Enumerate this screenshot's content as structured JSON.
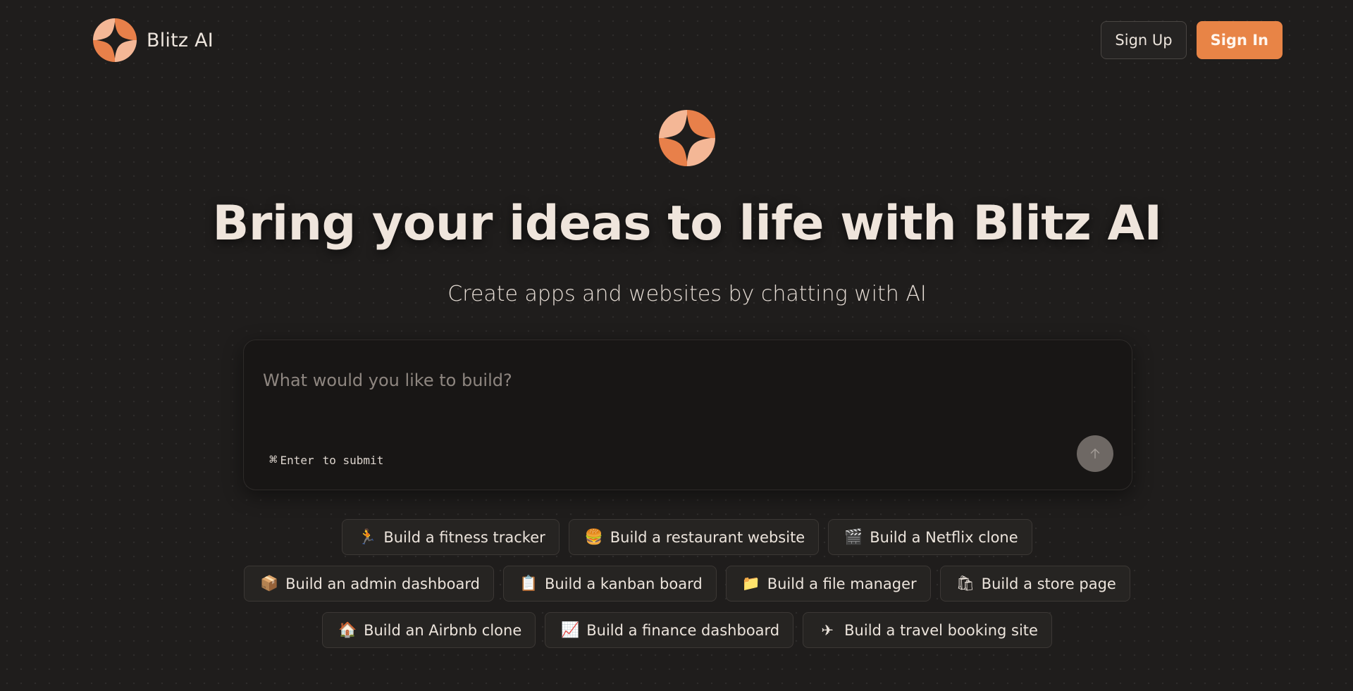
{
  "header": {
    "brand_name": "Blitz AI",
    "sign_up_label": "Sign Up",
    "sign_in_label": "Sign In"
  },
  "hero": {
    "title": "Bring your ideas to life with Blitz AI",
    "subtitle": "Create apps and websites by chatting with AI"
  },
  "prompt": {
    "placeholder": "What would you like to build?",
    "value": "",
    "shortcut_icon": "⌘",
    "shortcut_key": "Enter",
    "shortcut_hint": "to submit"
  },
  "suggestions": [
    [
      {
        "icon": "🏃",
        "icon_name": "runner-icon",
        "label": "Build a fitness tracker"
      },
      {
        "icon": "🍔",
        "icon_name": "burger-icon",
        "label": "Build a restaurant website"
      },
      {
        "icon": "🎬",
        "icon_name": "clapperboard-icon",
        "label": "Build a Netflix clone"
      }
    ],
    [
      {
        "icon": "📦",
        "icon_name": "package-icon",
        "label": "Build an admin dashboard"
      },
      {
        "icon": "📋",
        "icon_name": "clipboard-icon",
        "label": "Build a kanban board"
      },
      {
        "icon": "📁",
        "icon_name": "folder-icon",
        "label": "Build a file manager"
      },
      {
        "icon": "🛍",
        "icon_name": "shopping-bags-icon",
        "label": "Build a store page"
      }
    ],
    [
      {
        "icon": "🏠",
        "icon_name": "house-icon",
        "label": "Build an Airbnb clone"
      },
      {
        "icon": "📈",
        "icon_name": "chart-increasing-icon",
        "label": "Build a finance dashboard"
      },
      {
        "icon": "✈",
        "icon_name": "airplane-icon",
        "label": "Build a travel booking site"
      }
    ]
  ],
  "colors": {
    "background": "#1f1d1c",
    "accent": "#e88446",
    "logo_light": "#f4b796",
    "logo_dark": "#e8804a",
    "text": "#ece4dc"
  }
}
